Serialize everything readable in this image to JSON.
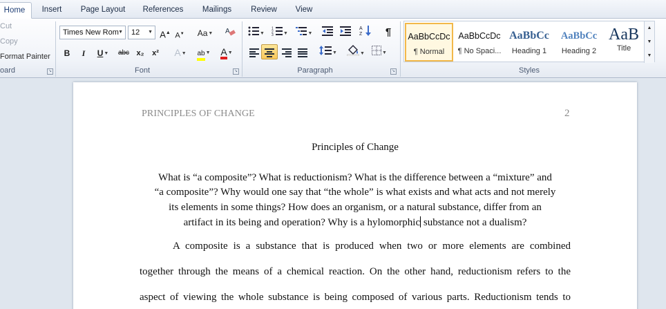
{
  "tabs": [
    "Home",
    "Insert",
    "Page Layout",
    "References",
    "Mailings",
    "Review",
    "View"
  ],
  "clipboard": {
    "cut": "Cut",
    "copy": "Copy",
    "format_painter": "Format Painter",
    "group_label": "oard"
  },
  "font": {
    "name": "Times New Rom",
    "size": "12",
    "grow": "A",
    "shrink": "A",
    "change_case": "Aa",
    "bold": "B",
    "italic": "I",
    "underline": "U",
    "strike": "abc",
    "sub": "x₂",
    "sup": "x²",
    "effects": "A",
    "highlight": "ab",
    "color": "A",
    "group_label": "Font"
  },
  "paragraph": {
    "pilcrow": "¶",
    "group_label": "Paragraph"
  },
  "styles": {
    "items": [
      {
        "sample": "AaBbCcDc",
        "name": "¶ Normal"
      },
      {
        "sample": "AaBbCcDc",
        "name": "¶ No Spaci..."
      },
      {
        "sample": "AaBbCc",
        "name": "Heading 1"
      },
      {
        "sample": "AaBbCc",
        "name": "Heading 2"
      },
      {
        "sample": "AaB",
        "name": "Title"
      }
    ],
    "group_label": "Styles"
  },
  "colors": {
    "accent_active": "#f9c85b",
    "heading_blue": "#365f91",
    "highlight_yellow": "#ffff00",
    "font_red": "#e02020"
  },
  "document": {
    "running_head": "PRINCIPLES OF CHANGE",
    "page_number": "2",
    "title": "Principles  of Change",
    "question_lines": [
      "What is “a composite”? What is reductionism? What is the difference between a “mixture” and",
      "“a composite”? Why would one say that “the whole” is what exists and what acts and not merely",
      "its elements in some things? How does an organism, or a natural substance, differ from an"
    ],
    "question_last_before_caret": "artifact in its being and operation? Why is a hylomorphic",
    "question_last_after_caret": " substance not a dualism?",
    "body_lines": [
      "A composite is a substance that is produced when two or more elements are combined",
      "together through the means of a chemical reaction. On the other hand, reductionism refers to the",
      "aspect of viewing the whole substance is being composed of various parts. Reductionism tends to"
    ]
  }
}
